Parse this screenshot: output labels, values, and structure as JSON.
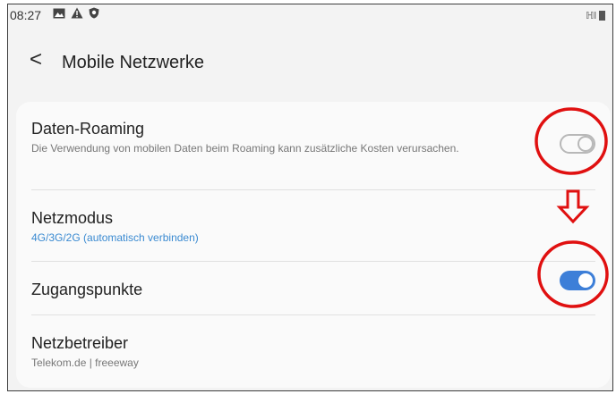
{
  "status_bar": {
    "time": "08:27",
    "icons": [
      "image-icon",
      "warning-icon",
      "shield-icon"
    ],
    "signal_label": "ℍl"
  },
  "app_bar": {
    "back_glyph": "<",
    "title": "Mobile Netzwerke"
  },
  "settings": [
    {
      "title": "Daten-Roaming",
      "subtitle": "Die Verwendung von mobilen Daten beim Roaming kann zusätzliche Kosten verursachen.",
      "toggle": "off"
    },
    {
      "title": "Netzmodus",
      "subtitle": "4G/3G/2G (automatisch verbinden)"
    },
    {
      "title": "Zugangspunkte",
      "toggle": "on"
    },
    {
      "title": "Netzbetreiber",
      "subtitle": "Telekom.de | freeeway"
    }
  ],
  "colors": {
    "accent": "#3d7fd8",
    "subtitle_link": "#3a8ad1",
    "annotation": "#e01010",
    "background": "#f3f3f3",
    "card": "#fafafa"
  }
}
